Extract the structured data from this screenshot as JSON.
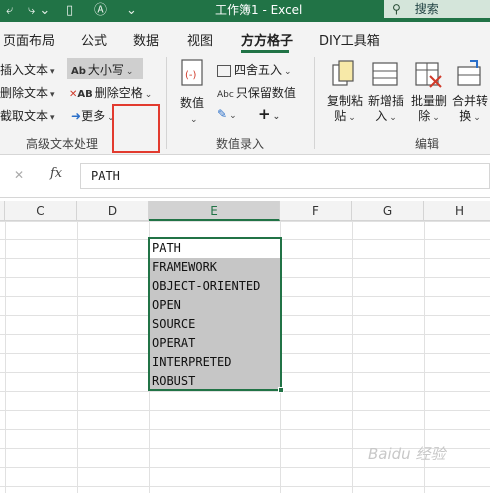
{
  "window": {
    "title": "工作簿1  -  Excel",
    "search_label": "搜索",
    "search_icon": "search-icon"
  },
  "tabs": [
    {
      "label": "页面布局",
      "active": false
    },
    {
      "label": "公式",
      "active": false
    },
    {
      "label": "数据",
      "active": false
    },
    {
      "label": "视图",
      "active": false
    },
    {
      "label": "方方格子",
      "active": true
    },
    {
      "label": "DIY工具箱",
      "active": false
    }
  ],
  "ribbon": {
    "text_group": {
      "label": "高级文本处理",
      "left_items": [
        "插入文本",
        "删除文本",
        "截取文本"
      ],
      "case_button": {
        "icon_text": "Ab",
        "label": "大小写"
      },
      "delete_spaces_button": {
        "icon_text": "AB",
        "label": "删除空格"
      },
      "more_button": "更多"
    },
    "number_group": {
      "label": "数值录入",
      "value_button": "数值",
      "round_button": "四舍五入",
      "keep_values_button": {
        "icon_text": "Abc",
        "label": "只保留数值"
      },
      "plus_label": "+"
    },
    "edit_group": {
      "label": "编辑",
      "buttons": [
        "复制粘贴",
        "新增插入",
        "批量删除",
        "合并转换"
      ]
    }
  },
  "formula_bar": {
    "cancel_icon": "✕",
    "fx_label": "fx",
    "value": "PATH"
  },
  "grid": {
    "columns": [
      "C",
      "D",
      "E",
      "F",
      "G",
      "H"
    ],
    "selected_column": "E",
    "cells": [
      "PATH",
      "FRAMEWORK",
      "OBJECT-ORIENTED",
      "OPEN",
      "SOURCE",
      "OPERAT",
      "INTERPRETED",
      "ROBUST"
    ]
  },
  "watermark": "Baidu 经验",
  "colors": {
    "excel_green": "#217346",
    "selection_gray": "#c6c6c6",
    "highlight_red": "#e23a2e"
  }
}
